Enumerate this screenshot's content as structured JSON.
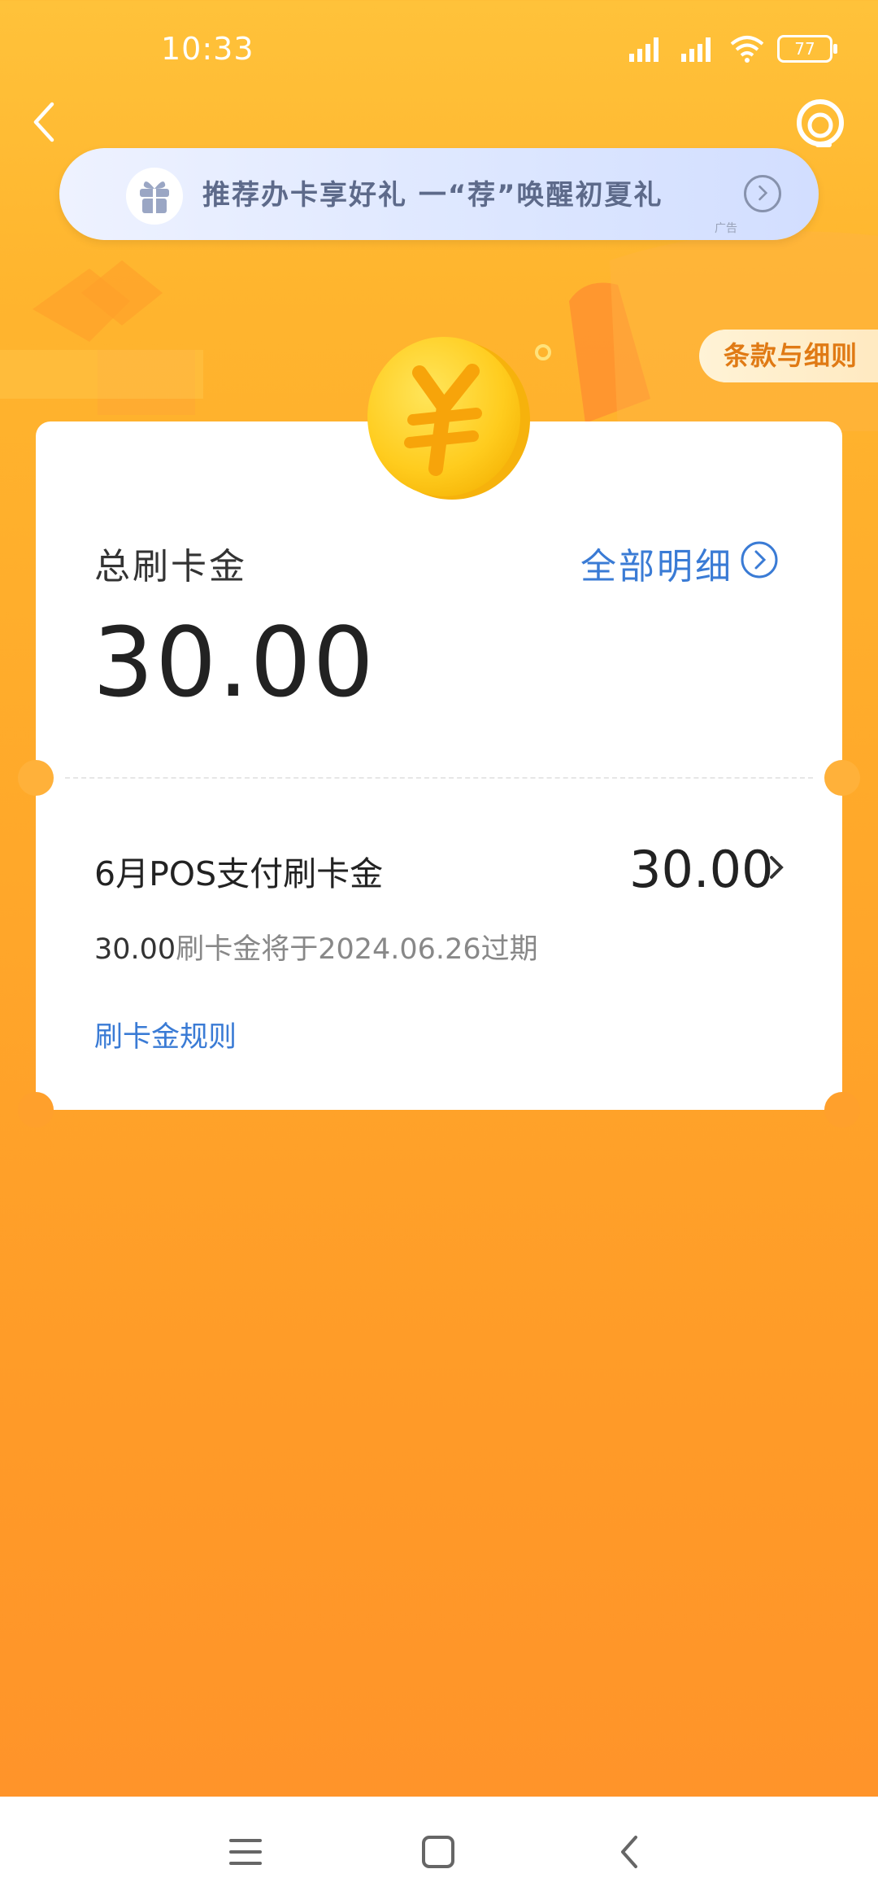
{
  "status_bar": {
    "time": "10:33",
    "battery": "77"
  },
  "banner": {
    "text": "推荐办卡享好礼  一“荐”唤醒初夏礼",
    "ad_label": "广告"
  },
  "terms_button": "条款与细则",
  "summary": {
    "label": "总刷卡金",
    "detail_link": "全部明细",
    "total": "30.00"
  },
  "item": {
    "title": "6月POS支付刷卡金",
    "value": "30.00",
    "expire_amount": "30.00",
    "expire_text": "刷卡金将于2024.06.26过期"
  },
  "rules_link": "刷卡金规则",
  "colors": {
    "accent_blue": "#3A7BD5",
    "background_orange": "#FFA82A",
    "terms_orange": "#E07A14"
  },
  "icons": [
    "back-arrow-icon",
    "customer-service-icon",
    "gift-icon",
    "chevron-right-icon",
    "yen-coin-icon",
    "menu-icon",
    "home-icon",
    "back-icon"
  ]
}
